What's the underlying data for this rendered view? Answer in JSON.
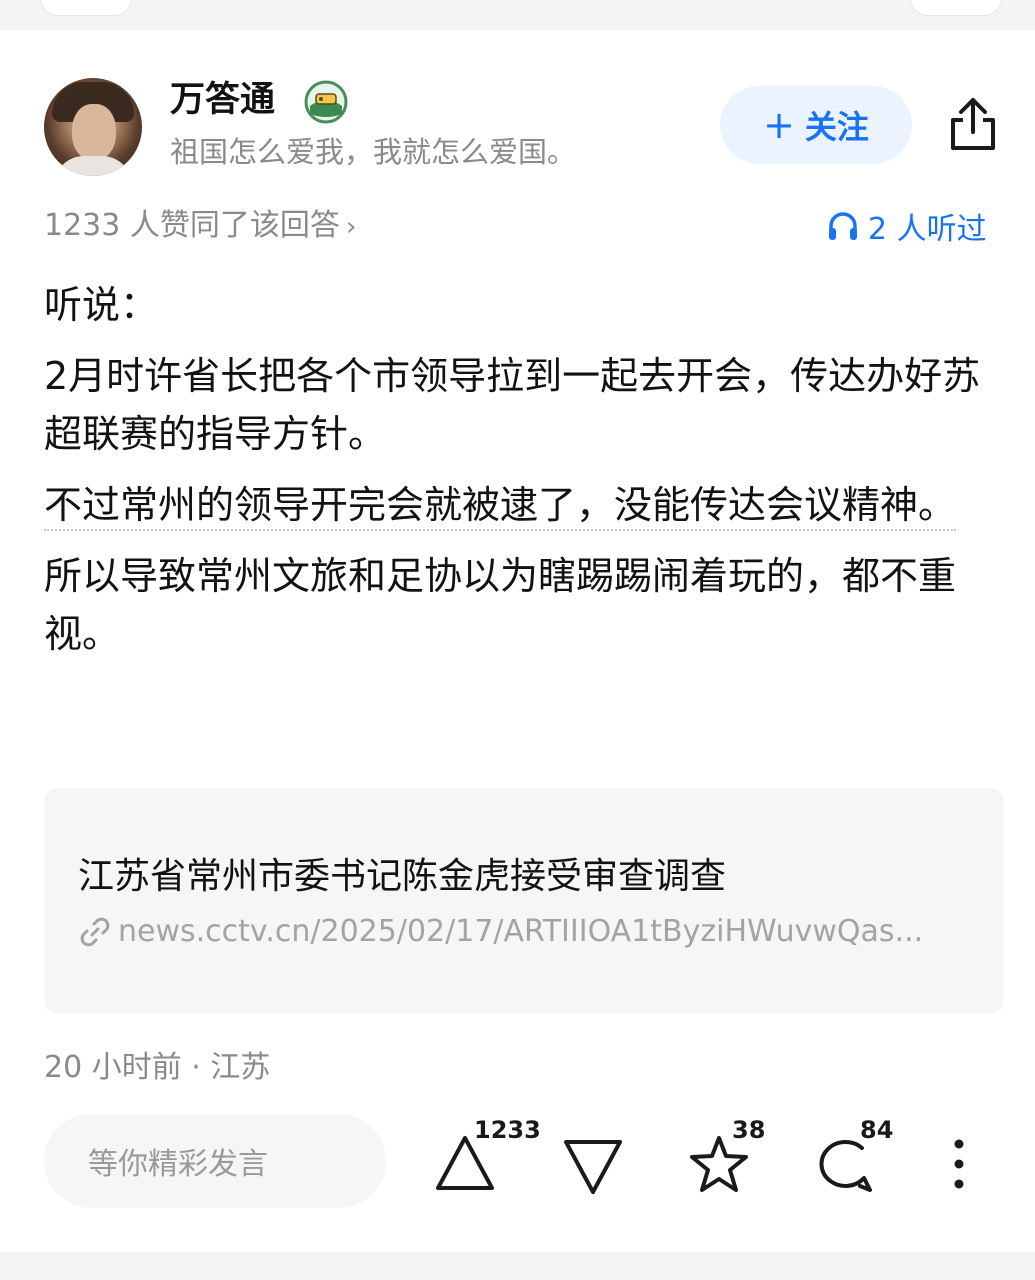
{
  "author": {
    "name": "万答通",
    "bio": "祖国怎么爱我，我就怎么爱国。",
    "follow_label": "关注"
  },
  "stats": {
    "agree_text": "1233 人赞同了该回答",
    "agree_chevron": "›",
    "listen_text": "2 人听过"
  },
  "content": {
    "paragraphs": [
      "听说：",
      "2月时许省长把各个市领导拉到一起去开会，传达办好苏超联赛的指导方针。",
      "不过常州的领导开完会就被逮了，没能传达会议精神。",
      "所以导致常州文旅和足协以为瞎踢踢闹着玩的，都不重视。"
    ]
  },
  "link_card": {
    "title": "江苏省常州市委书记陈金虎接受审查调查",
    "url": "news.cctv.cn/2025/02/17/ARTIIIOA1tByziHWuvwQas..."
  },
  "meta": {
    "time_location": "20 小时前 · 江苏"
  },
  "bottom_bar": {
    "comment_placeholder": "等你精彩发言",
    "upvote_count": "1233",
    "favorite_count": "38",
    "comment_count": "84"
  },
  "colors": {
    "accent": "#1772f6",
    "follow_bg": "#ebf3ff",
    "muted_text": "#8a8a8a",
    "card_bg": "#f6f6f6"
  },
  "icons": [
    "badge-icon",
    "share-icon",
    "headphones-icon",
    "link-icon",
    "upvote-icon",
    "downvote-icon",
    "star-icon",
    "comment-icon",
    "more-icon"
  ]
}
